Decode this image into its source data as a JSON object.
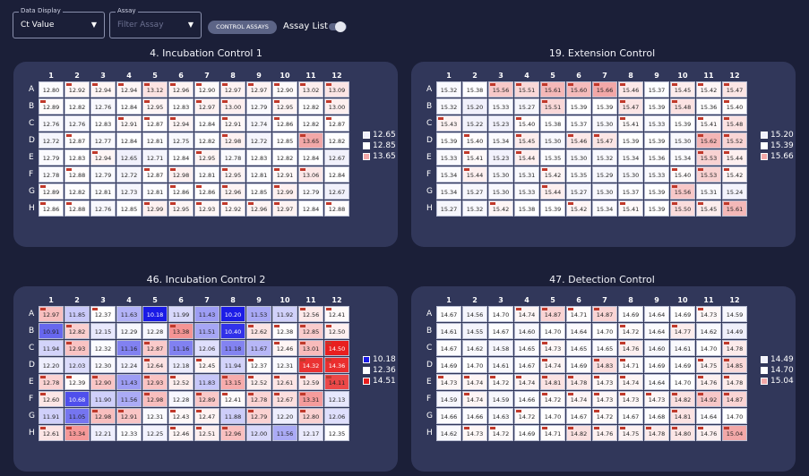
{
  "toolbar": {
    "data_display_label": "Data Display",
    "data_display_value": "Ct Value",
    "assay_label": "Assay",
    "assay_placeholder": "Filter Assay",
    "control_button": "CONTROL ASSAYS",
    "assay_list_label": "Assay List"
  },
  "columns": [
    "1",
    "2",
    "3",
    "4",
    "5",
    "6",
    "7",
    "8",
    "9",
    "10",
    "11",
    "12"
  ],
  "rows": [
    "A",
    "B",
    "C",
    "D",
    "E",
    "F",
    "G",
    "H"
  ],
  "plates": [
    {
      "title": "4. Incubation Control 1",
      "legend": [
        "12.65",
        "12.85",
        "13.65"
      ],
      "legend_colors": [
        "#f0f0fb",
        "#ffffff",
        "#f2a8a8"
      ],
      "min": 12.65,
      "mid": 12.85,
      "max": 13.65,
      "values": [
        [
          12.8,
          12.92,
          12.94,
          12.94,
          13.12,
          12.96,
          12.9,
          12.97,
          12.97,
          12.9,
          13.02,
          13.09
        ],
        [
          12.89,
          12.82,
          12.76,
          12.84,
          12.95,
          12.83,
          12.97,
          13.0,
          12.79,
          12.95,
          12.82,
          13.0
        ],
        [
          12.76,
          12.76,
          12.83,
          12.91,
          12.87,
          12.94,
          12.84,
          12.91,
          12.74,
          12.86,
          12.82,
          12.87
        ],
        [
          12.72,
          12.87,
          12.77,
          12.84,
          12.81,
          12.75,
          12.82,
          12.98,
          12.72,
          12.85,
          13.65,
          12.82
        ],
        [
          12.79,
          12.83,
          12.94,
          12.65,
          12.71,
          12.84,
          12.95,
          12.78,
          12.83,
          12.82,
          12.84,
          12.67
        ],
        [
          12.78,
          12.88,
          12.79,
          12.72,
          12.87,
          12.98,
          12.81,
          12.95,
          12.81,
          12.91,
          13.06,
          12.84
        ],
        [
          12.89,
          12.82,
          12.81,
          12.73,
          12.81,
          12.86,
          12.86,
          12.96,
          12.85,
          12.99,
          12.79,
          12.67
        ],
        [
          12.86,
          12.88,
          12.76,
          12.85,
          12.99,
          12.95,
          12.93,
          12.92,
          12.96,
          12.97,
          12.84,
          12.88
        ]
      ]
    },
    {
      "title": "19. Extension Control",
      "legend": [
        "15.20",
        "15.39",
        "15.66"
      ],
      "legend_colors": [
        "#f0f0fb",
        "#ffffff",
        "#f2a8a8"
      ],
      "min": 15.2,
      "mid": 15.39,
      "max": 15.66,
      "values": [
        [
          15.32,
          15.38,
          15.56,
          15.51,
          15.61,
          15.6,
          15.66,
          15.46,
          15.37,
          15.45,
          15.42,
          15.47
        ],
        [
          15.32,
          15.2,
          15.33,
          15.27,
          15.51,
          15.39,
          15.39,
          15.47,
          15.39,
          15.48,
          15.36,
          15.4
        ],
        [
          15.43,
          15.22,
          15.23,
          15.4,
          15.38,
          15.37,
          15.3,
          15.41,
          15.33,
          15.39,
          15.41,
          15.48
        ],
        [
          15.39,
          15.4,
          15.34,
          15.45,
          15.3,
          15.46,
          15.47,
          15.39,
          15.39,
          15.3,
          15.62,
          15.52
        ],
        [
          15.33,
          15.41,
          15.23,
          15.44,
          15.35,
          15.3,
          15.32,
          15.34,
          15.36,
          15.34,
          15.53,
          15.44
        ],
        [
          15.34,
          15.44,
          15.3,
          15.31,
          15.42,
          15.35,
          15.29,
          15.3,
          15.33,
          15.4,
          15.53,
          15.42
        ],
        [
          15.34,
          15.27,
          15.3,
          15.33,
          15.44,
          15.27,
          15.3,
          15.37,
          15.39,
          15.56,
          15.31,
          15.24
        ],
        [
          15.27,
          15.32,
          15.42,
          15.38,
          15.39,
          15.42,
          15.34,
          15.41,
          15.39,
          15.5,
          15.45,
          15.61
        ]
      ]
    },
    {
      "title": "46. Incubation Control 2",
      "legend": [
        "10.18",
        "12.36",
        "14.51"
      ],
      "legend_colors": [
        "#1a1ae6",
        "#ffffff",
        "#e81e1e"
      ],
      "min": 10.18,
      "mid": 12.36,
      "max": 14.51,
      "values": [
        [
          12.97,
          11.85,
          12.37,
          11.63,
          10.18,
          11.99,
          11.43,
          10.2,
          11.53,
          11.92,
          12.56,
          12.41
        ],
        [
          10.91,
          12.82,
          12.15,
          12.29,
          12.28,
          13.38,
          11.51,
          10.4,
          12.62,
          12.38,
          12.85,
          12.5
        ],
        [
          11.94,
          12.93,
          12.32,
          11.16,
          12.87,
          11.16,
          12.06,
          11.18,
          11.67,
          12.46,
          13.01,
          14.5
        ],
        [
          12.2,
          12.03,
          12.3,
          12.24,
          12.64,
          12.18,
          12.45,
          11.94,
          12.37,
          12.31,
          14.32,
          14.36
        ],
        [
          12.78,
          12.39,
          12.9,
          11.43,
          12.93,
          12.52,
          11.83,
          13.15,
          12.52,
          12.61,
          12.59,
          14.11
        ],
        [
          12.6,
          10.68,
          11.9,
          11.56,
          12.98,
          12.28,
          12.89,
          12.41,
          12.78,
          12.67,
          13.31,
          12.13
        ],
        [
          11.91,
          11.05,
          12.98,
          12.91,
          12.31,
          12.43,
          12.47,
          11.88,
          12.79,
          12.2,
          12.8,
          12.06
        ],
        [
          12.61,
          13.34,
          12.21,
          12.33,
          12.25,
          12.46,
          12.51,
          12.96,
          12.0,
          11.56,
          12.17,
          12.35
        ]
      ]
    },
    {
      "title": "47. Detection Control",
      "legend": [
        "14.49",
        "14.70",
        "15.04"
      ],
      "legend_colors": [
        "#f0f0fb",
        "#ffffff",
        "#f2a8a8"
      ],
      "min": 14.49,
      "mid": 14.7,
      "max": 15.04,
      "values": [
        [
          14.67,
          14.56,
          14.7,
          14.74,
          14.87,
          14.71,
          14.87,
          14.69,
          14.64,
          14.69,
          14.73,
          14.59
        ],
        [
          14.61,
          14.55,
          14.67,
          14.6,
          14.7,
          14.64,
          14.7,
          14.72,
          14.64,
          14.77,
          14.62,
          14.49
        ],
        [
          14.67,
          14.62,
          14.58,
          14.65,
          14.73,
          14.65,
          14.65,
          14.76,
          14.6,
          14.61,
          14.7,
          14.78
        ],
        [
          14.69,
          14.7,
          14.61,
          14.67,
          14.74,
          14.69,
          14.83,
          14.71,
          14.69,
          14.69,
          14.75,
          14.85
        ],
        [
          14.73,
          14.74,
          14.72,
          14.74,
          14.81,
          14.78,
          14.73,
          14.74,
          14.64,
          14.7,
          14.76,
          14.78
        ],
        [
          14.59,
          14.74,
          14.59,
          14.66,
          14.72,
          14.74,
          14.73,
          14.73,
          14.73,
          14.82,
          14.92,
          14.87
        ],
        [
          14.66,
          14.66,
          14.63,
          14.72,
          14.7,
          14.67,
          14.72,
          14.67,
          14.68,
          14.81,
          14.64,
          14.7
        ],
        [
          14.62,
          14.73,
          14.72,
          14.69,
          14.71,
          14.82,
          14.76,
          14.75,
          14.78,
          14.8,
          14.76,
          15.04
        ]
      ]
    }
  ]
}
